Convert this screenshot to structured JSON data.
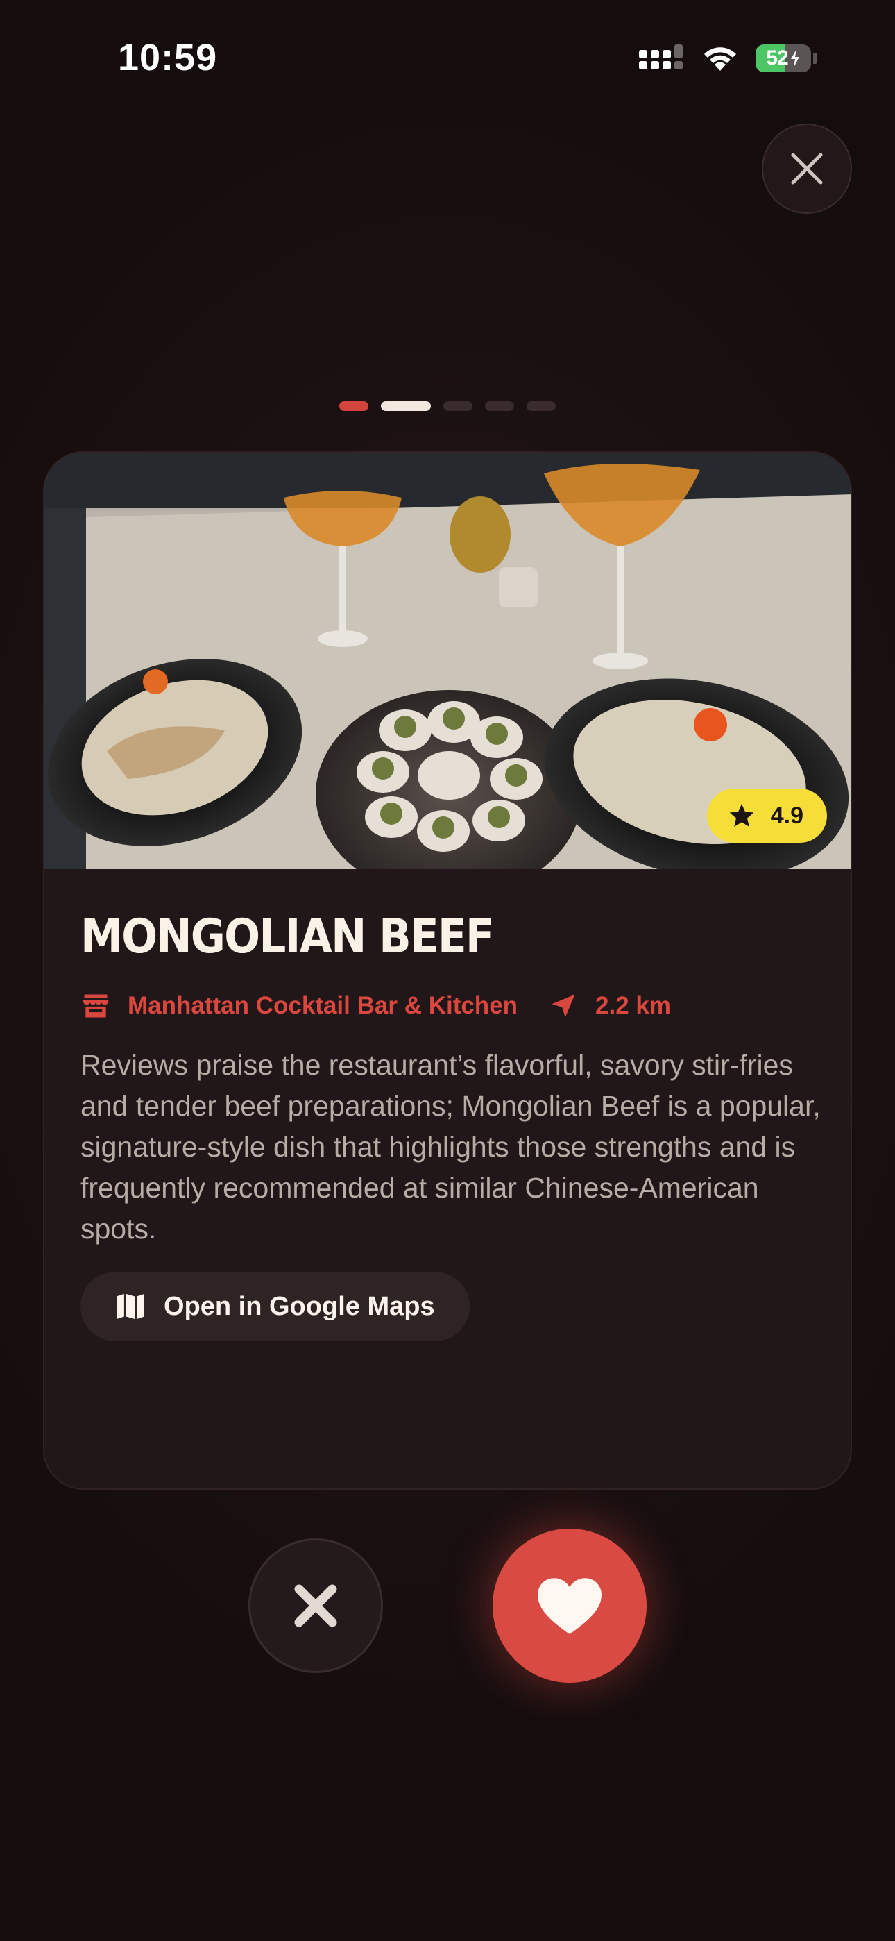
{
  "status_bar": {
    "time": "10:59",
    "battery_percent": "52",
    "battery_level": 0.52,
    "icons": [
      "cellular-signal-icon",
      "wifi-icon",
      "battery-charging-icon"
    ]
  },
  "header": {
    "close_icon": "close-icon"
  },
  "pager": {
    "count": 5,
    "current_index": 1
  },
  "card": {
    "photo_alt": "Food photo",
    "rating": "4.9",
    "rating_icon": "star-icon",
    "dish_name": "MONGOLIAN BEEF",
    "restaurant_icon": "storefront-icon",
    "restaurant_name": "Manhattan Cocktail Bar & Kitchen",
    "distance_icon": "location-arrow-icon",
    "distance": "2.2 km",
    "description": "Reviews praise the restaurant’s flavorful, savory stir-fries and tender beef preparations; Mongolian Beef is a popular, signature-style dish that highlights those strengths and is frequently recommended at similar Chinese-American spots.",
    "maps_button_label": "Open in Google Maps",
    "maps_icon": "map-icon"
  },
  "actions": {
    "dislike_icon": "x-icon",
    "like_icon": "heart-icon"
  },
  "colors": {
    "accent": "#d94a43",
    "rating_badge": "#f7dd38",
    "card_bg": "#221718",
    "page_bg": "#1c1112"
  }
}
